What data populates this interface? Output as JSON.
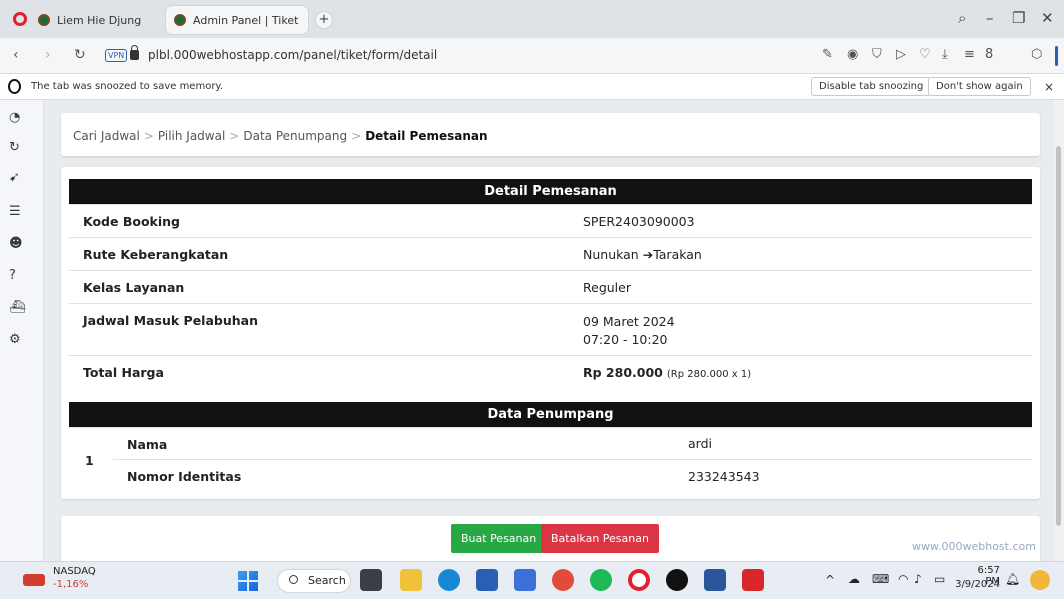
{
  "browser": {
    "tabs": [
      {
        "title": "Liem Hie Djung"
      },
      {
        "title": "Admin Panel | Tiket"
      }
    ],
    "new_tab": "+",
    "url_badge": "VPN",
    "url": "plbl.000webhostapp.com/panel/tiket/form/detail",
    "snooze": {
      "message": "The tab was snoozed to save memory.",
      "disable_label": "Disable tab snoozing",
      "dont_show_label": "Don't show again",
      "close": "×"
    }
  },
  "breadcrumb": {
    "items": [
      "Cari Jadwal",
      "Pilih Jadwal",
      "Data Penumpang"
    ],
    "separator": ">",
    "current": "Detail Pemesanan"
  },
  "detail": {
    "header": "Detail Pemesanan",
    "rows": [
      {
        "label": "Kode Booking",
        "value": "SPER2403090003"
      },
      {
        "label": "Rute Keberangkatan",
        "from": "Nunukan",
        "arrow": "➔",
        "to": "Tarakan"
      },
      {
        "label": "Kelas Layanan",
        "value": "Reguler"
      },
      {
        "label": "Jadwal Masuk Pelabuhan",
        "date": "09 Maret 2024",
        "time": "07:20 - 10:20"
      },
      {
        "label": "Total Harga",
        "price": "Rp 280.000",
        "note": "(Rp 280.000 x 1)"
      }
    ]
  },
  "passengers": {
    "header": "Data Penumpang",
    "items": [
      {
        "no": "1",
        "name_label": "Nama",
        "name": "ardi",
        "id_label": "Nomor Identitas",
        "id": "233243543"
      }
    ]
  },
  "actions": {
    "create": "Buat Pesanan",
    "cancel": "Batalkan Pesanan"
  },
  "watermark": "www.000webhost.com",
  "taskbar": {
    "stock_name": "NASDAQ",
    "stock_change": "-1,16%",
    "search_label": "Search",
    "time": "6:57 PM",
    "date": "3/9/2024"
  },
  "colors": {
    "table_header": "#111111",
    "btn_green": "#28a745",
    "btn_red": "#dc3545",
    "opera_red": "#e5202e"
  }
}
